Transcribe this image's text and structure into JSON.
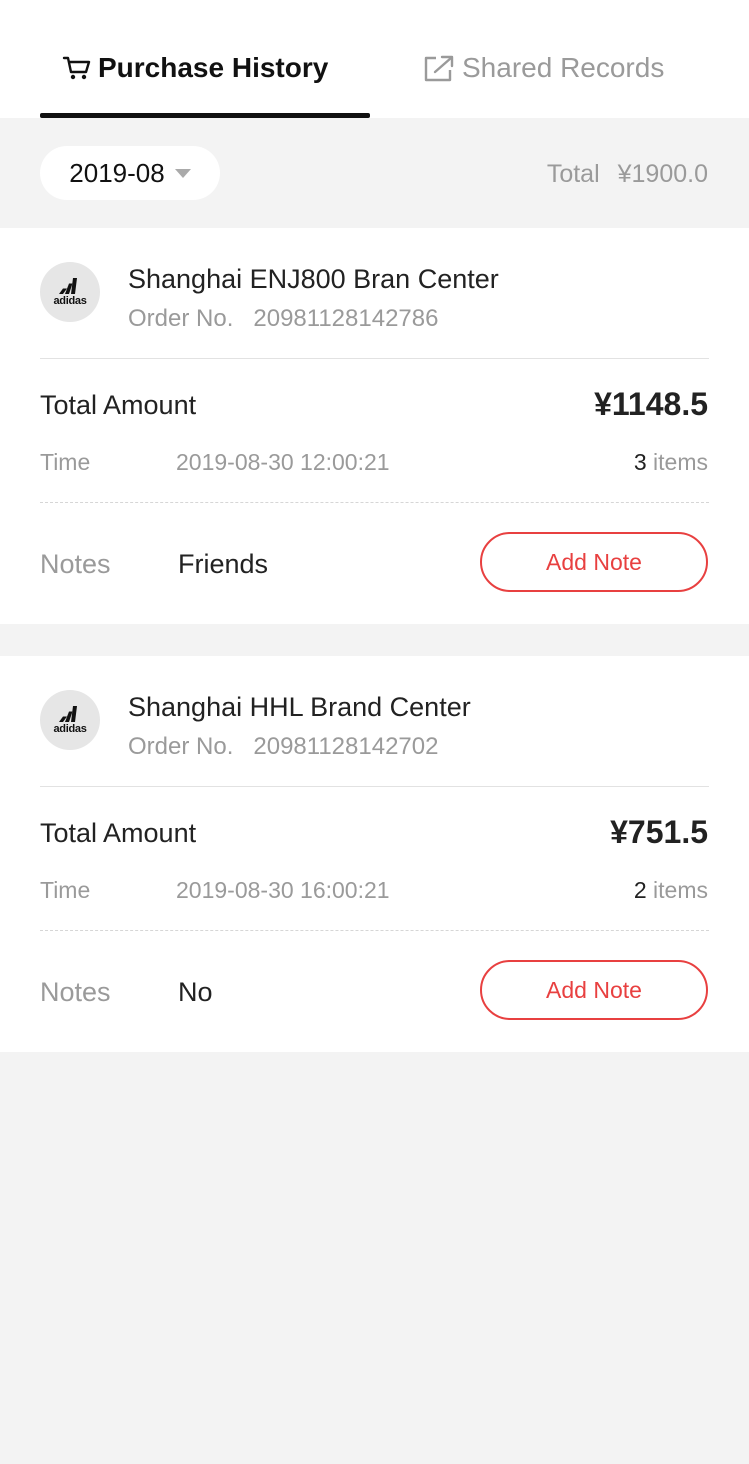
{
  "tabs": {
    "purchase_history": "Purchase History",
    "shared_records": "Shared Records"
  },
  "filter": {
    "month": "2019-08",
    "total_label": "Total",
    "total_value": "¥1900.0"
  },
  "labels": {
    "order_no": "Order No.",
    "total_amount": "Total Amount",
    "time": "Time",
    "items_suffix": "items",
    "notes": "Notes",
    "add_note": "Add Note",
    "brand_logo": "adidas"
  },
  "orders": [
    {
      "store": "Shanghai ENJ800 Bran Center",
      "order_no": "20981128142786",
      "amount": "¥1148.5",
      "time": "2019-08-30 12:00:21",
      "items": "3",
      "notes": "Friends"
    },
    {
      "store": "Shanghai HHL Brand Center",
      "order_no": "20981128142702",
      "amount": "¥751.5",
      "time": "2019-08-30 16:00:21",
      "items": "2",
      "notes": "No"
    }
  ],
  "colors": {
    "accent": "#e84040",
    "background": "#f3f3f3",
    "muted_text": "#9a9a9a"
  },
  "icons": {
    "active_tab": "cart-icon",
    "inactive_tab": "share-icon",
    "month_dropdown": "caret-down-icon",
    "store": "adidas-logo"
  }
}
